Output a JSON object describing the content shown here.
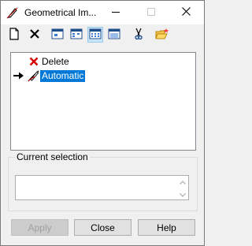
{
  "window": {
    "title": "Geometrical Im...",
    "minimize_icon": "minimize-icon",
    "maximize_icon": "maximize-icon",
    "close_icon": "close-icon"
  },
  "toolbar": {
    "items": [
      {
        "name": "new-icon"
      },
      {
        "name": "delete-x-icon"
      },
      {
        "name": "view-large-icons-icon"
      },
      {
        "name": "view-small-icons-icon"
      },
      {
        "name": "view-list-icon",
        "pressed": true
      },
      {
        "name": "view-details-icon"
      },
      {
        "name": "cut-icon"
      },
      {
        "name": "open-folder-icon"
      }
    ]
  },
  "tree": {
    "items": [
      {
        "label": "Delete",
        "icon": "red-x-icon",
        "selected": false
      },
      {
        "label": "Automatic",
        "icon": "pen-icon",
        "selected": true,
        "current": true
      }
    ]
  },
  "current_selection": {
    "label": "Current selection",
    "value": ""
  },
  "buttons": {
    "apply": "Apply",
    "close": "Close",
    "help": "Help"
  },
  "colors": {
    "selection": "#0078d7",
    "delete_red": "#d40000"
  }
}
